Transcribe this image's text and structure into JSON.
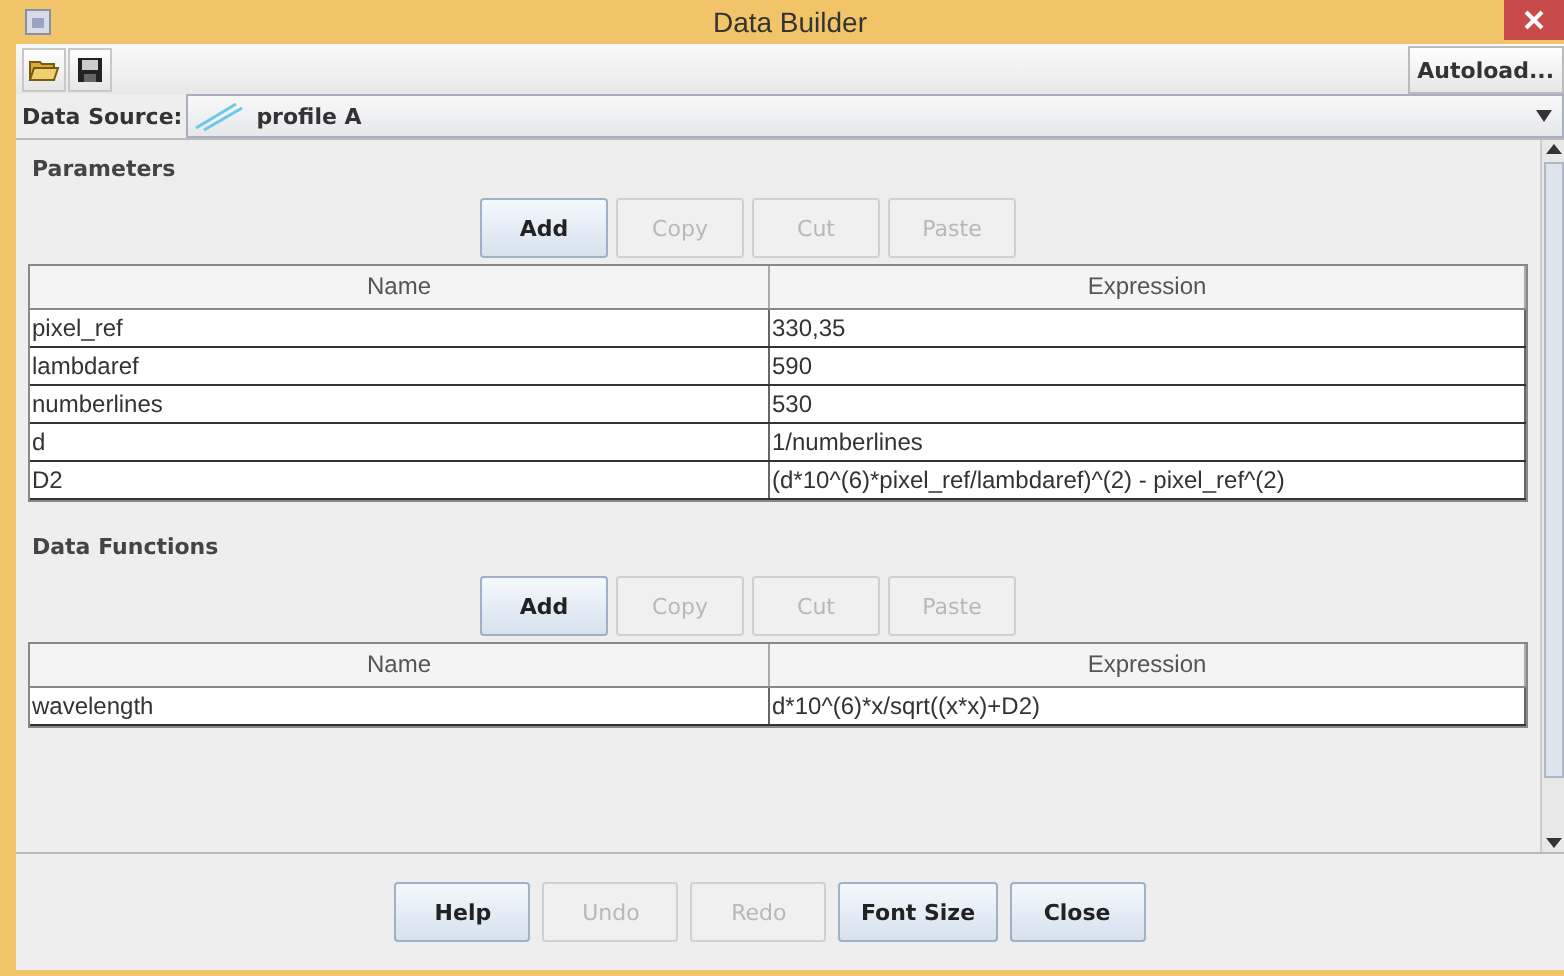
{
  "window": {
    "title": "Data Builder"
  },
  "toolbar": {
    "autoload_button": "Autoload..."
  },
  "data_source": {
    "label": "Data Source:",
    "value": "profile A"
  },
  "sections": [
    {
      "title": "Parameters",
      "buttons": [
        {
          "label": "Add",
          "disabled": false
        },
        {
          "label": "Copy",
          "disabled": true
        },
        {
          "label": "Cut",
          "disabled": true
        },
        {
          "label": "Paste",
          "disabled": true
        }
      ],
      "columns": [
        "Name",
        "Expression"
      ],
      "rows": [
        [
          "pixel_ref",
          "330,35"
        ],
        [
          "lambdaref",
          "590"
        ],
        [
          "numberlines",
          "530"
        ],
        [
          "d",
          "1/numberlines"
        ],
        [
          "D2",
          "(d*10^(6)*pixel_ref/lambdaref)^(2) - pixel_ref^(2)"
        ]
      ]
    },
    {
      "title": "Data Functions",
      "buttons": [
        {
          "label": "Add",
          "disabled": false
        },
        {
          "label": "Copy",
          "disabled": true
        },
        {
          "label": "Cut",
          "disabled": true
        },
        {
          "label": "Paste",
          "disabled": true
        }
      ],
      "columns": [
        "Name",
        "Expression"
      ],
      "rows": [
        [
          "wavelength",
          "d*10^(6)*x/sqrt((x*x)+D2)"
        ]
      ]
    }
  ],
  "buttons": [
    {
      "label": "Help",
      "disabled": false
    },
    {
      "label": "Undo",
      "disabled": true
    },
    {
      "label": "Redo",
      "disabled": true
    },
    {
      "label": "Font Size",
      "disabled": false
    },
    {
      "label": "Close",
      "disabled": false
    }
  ]
}
